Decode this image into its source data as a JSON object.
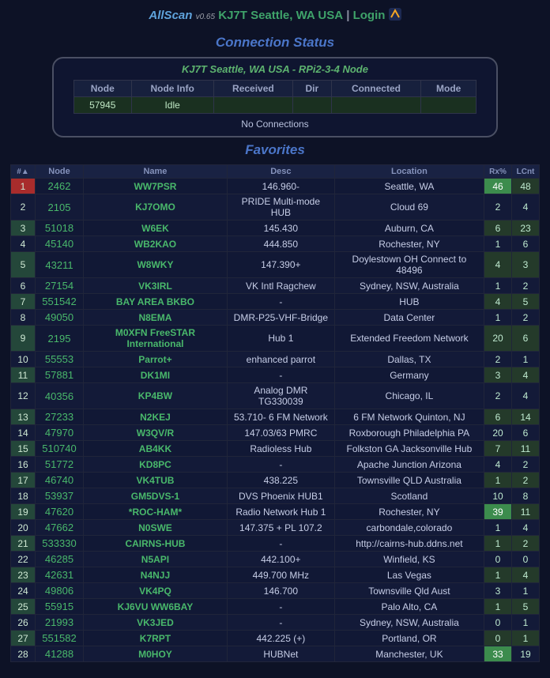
{
  "top": {
    "brand": "AllScan",
    "ver": "v0.65",
    "loc": "KJ7T Seattle, WA USA",
    "sep": "|",
    "login": "Login"
  },
  "status": {
    "heading": "Connection Status",
    "title": "KJ7T Seattle, WA USA - RPi2-3-4 Node",
    "headers": [
      "Node",
      "Node Info",
      "Received",
      "Dir",
      "Connected",
      "Mode"
    ],
    "row": {
      "node": "57945",
      "info": "Idle",
      "received": "",
      "dir": "",
      "connected": "",
      "mode": ""
    },
    "noConn": "No Connections"
  },
  "favorites": {
    "heading": "Favorites",
    "headers": [
      "#▲",
      "Node",
      "Name",
      "Desc",
      "Location",
      "Rx%",
      "LCnt"
    ]
  },
  "chart_data": {
    "type": "table",
    "columns": [
      "#",
      "Node",
      "Name",
      "Desc",
      "Location",
      "Rx%",
      "LCnt"
    ],
    "rows": [
      [
        1,
        2462,
        "WW7PSR",
        "146.960-",
        "Seattle, WA",
        46,
        48
      ],
      [
        2,
        2105,
        "KJ7OMO",
        "PRIDE Multi-mode HUB",
        "Cloud 69",
        2,
        4
      ],
      [
        3,
        51018,
        "W6EK",
        "145.430",
        "Auburn, CA",
        6,
        23
      ],
      [
        4,
        45140,
        "WB2KAO",
        "444.850",
        "Rochester, NY",
        1,
        6
      ],
      [
        5,
        43211,
        "W8WKY",
        "147.390+",
        "Doylestown OH Connect to 48496",
        4,
        3
      ],
      [
        6,
        27154,
        "VK3IRL",
        "VK Intl Ragchew",
        "Sydney, NSW, Australia",
        1,
        2
      ],
      [
        7,
        551542,
        "BAY AREA BKBO",
        "-",
        "HUB",
        4,
        5
      ],
      [
        8,
        49050,
        "N8EMA",
        "DMR-P25-VHF-Bridge",
        "Data Center",
        1,
        2
      ],
      [
        9,
        2195,
        "M0XFN FreeSTAR International",
        "Hub 1",
        "Extended Freedom Network",
        20,
        6
      ],
      [
        10,
        55553,
        "Parrot+",
        "enhanced parrot",
        "Dallas, TX",
        2,
        1
      ],
      [
        11,
        57881,
        "DK1MI",
        "-",
        "Germany",
        3,
        4
      ],
      [
        12,
        40356,
        "KP4BW",
        "Analog DMR TG330039",
        "Chicago, IL",
        2,
        4
      ],
      [
        13,
        27233,
        "N2KEJ",
        "53.710- 6 FM Network",
        "6 FM Network Quinton, NJ",
        6,
        14
      ],
      [
        14,
        47970,
        "W3QV/R",
        "147.03/63 PMRC",
        "Roxborough Philadelphia PA",
        20,
        6
      ],
      [
        15,
        510740,
        "AB4KK",
        "Radioless Hub",
        "Folkston GA Jacksonville Hub",
        7,
        11
      ],
      [
        16,
        51772,
        "KD8PC",
        "-",
        "Apache Junction Arizona",
        4,
        2
      ],
      [
        17,
        46740,
        "VK4TUB",
        "438.225",
        "Townsville QLD Australia",
        1,
        2
      ],
      [
        18,
        53937,
        "GM5DVS-1",
        "DVS Phoenix HUB1",
        "Scotland",
        10,
        8
      ],
      [
        19,
        47620,
        "*ROC-HAM*",
        "Radio Network Hub 1",
        "Rochester, NY",
        39,
        11
      ],
      [
        20,
        47662,
        "N0SWE",
        "147.375 + PL 107.2",
        "carbondale,colorado",
        1,
        4
      ],
      [
        21,
        533330,
        "CAIRNS-HUB",
        "-",
        "http://cairns-hub.ddns.net",
        1,
        2
      ],
      [
        22,
        46285,
        "N5API",
        "442.100+",
        "Winfield, KS",
        0,
        0
      ],
      [
        23,
        42631,
        "N4NJJ",
        "449.700 MHz",
        "Las Vegas",
        1,
        4
      ],
      [
        24,
        49806,
        "VK4PQ",
        "146.700",
        "Townsville Qld Aust",
        3,
        1
      ],
      [
        25,
        55915,
        "KJ6VU WW6BAY",
        "-",
        "Palo Alto, CA",
        1,
        5
      ],
      [
        26,
        21993,
        "VK3JED",
        "-",
        "Sydney, NSW, Australia",
        0,
        1
      ],
      [
        27,
        551582,
        "K7RPT",
        "442.225 (+)",
        "Portland, OR",
        0,
        1
      ],
      [
        28,
        41288,
        "M0HOY",
        "HUBNet",
        "Manchester, UK",
        33,
        19
      ]
    ]
  }
}
